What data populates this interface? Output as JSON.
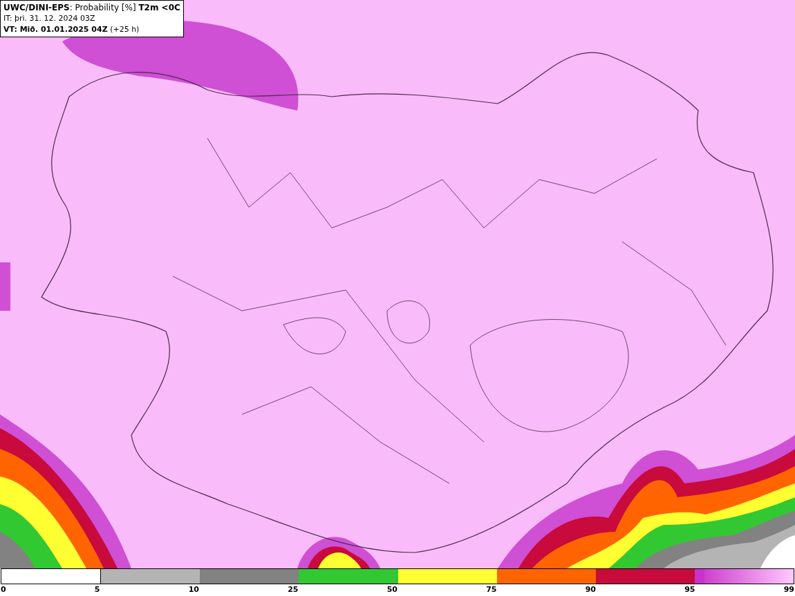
{
  "header": {
    "lines": [
      "**UWC/DINI-EPS**: Probability [%] **T2m <0C**",
      "IT: þri. 31. 12. 2024 03Z",
      "**VT: Mið. 01.01.2025 04Z** (+25 h)"
    ]
  },
  "legend": {
    "segments": [
      {
        "color": "#ffffff"
      },
      {
        "color": "#b4b4b4"
      },
      {
        "color": "#828282"
      },
      {
        "color": "#32c832"
      },
      {
        "color": "#ffff32"
      },
      {
        "color": "#ff6400"
      },
      {
        "color": "#c80a3c"
      },
      {
        "color": "#c832c8"
      }
    ],
    "labels": [
      "0",
      "5",
      "10",
      "25",
      "50",
      "75",
      "90",
      "95",
      "99"
    ]
  }
}
